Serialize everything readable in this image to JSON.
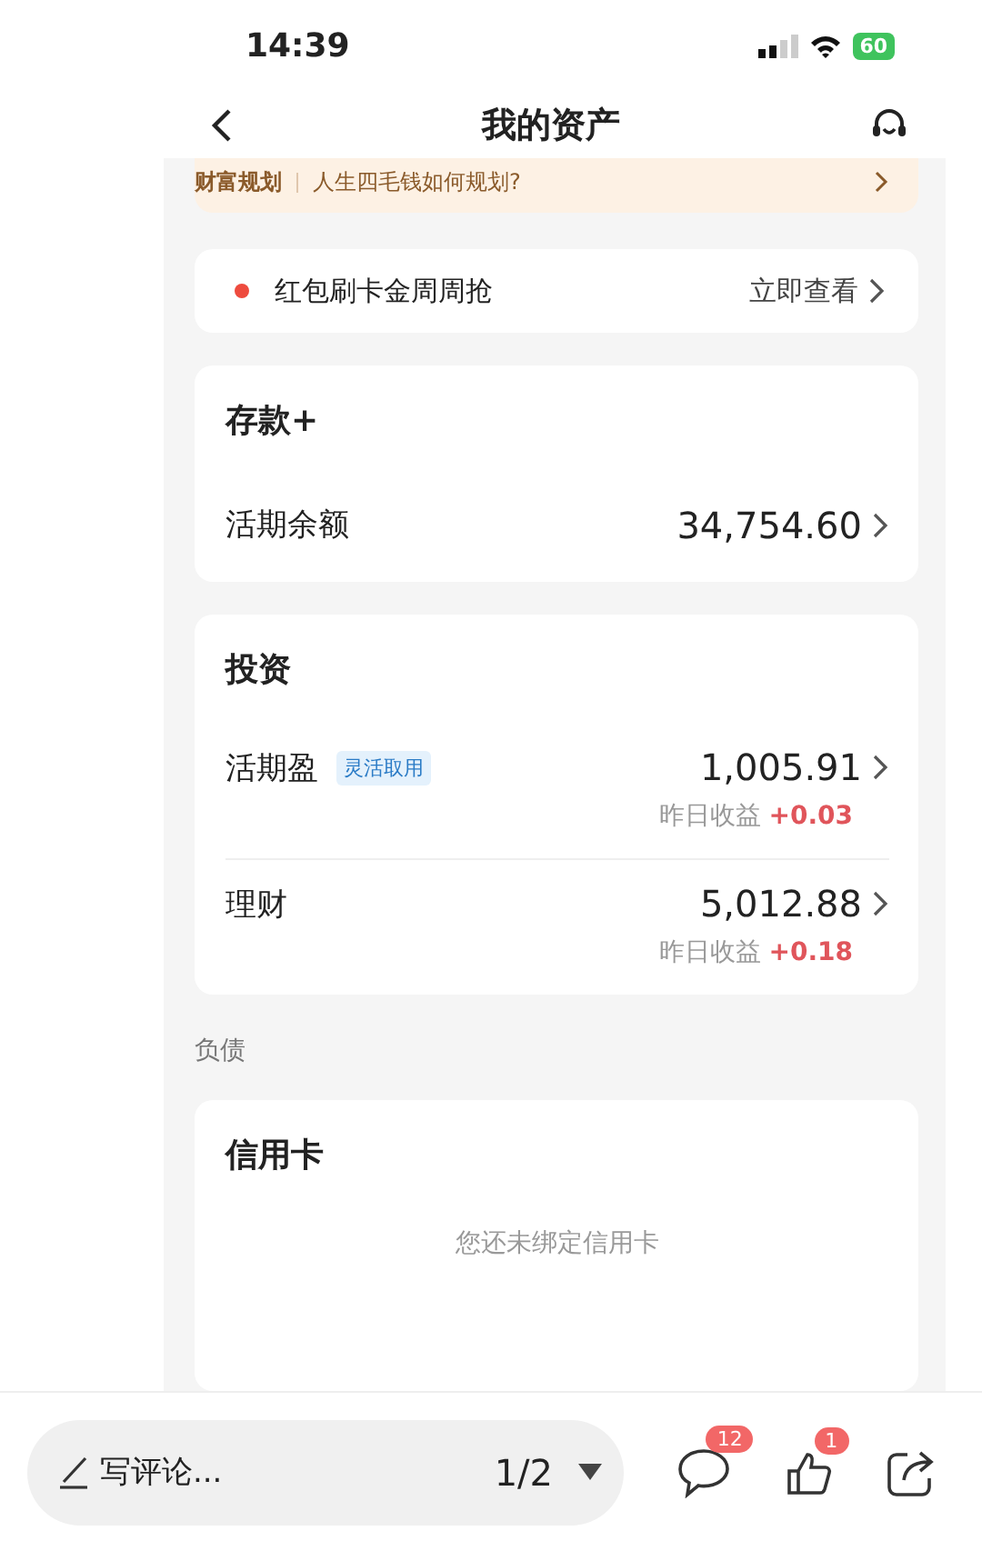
{
  "status_bar": {
    "time": "14:39",
    "battery": "60"
  },
  "nav": {
    "title": "我的资产"
  },
  "banner": {
    "tag": "财富规划",
    "text": "人生四毛钱如何规划?"
  },
  "promo": {
    "text": "红包刷卡金周周抢",
    "link": "立即查看"
  },
  "deposit": {
    "title": "存款+",
    "rows": [
      {
        "label": "活期余额",
        "amount": "34,754.60"
      }
    ]
  },
  "invest": {
    "title": "投资",
    "rows": [
      {
        "label": "活期盈",
        "tag": "灵活取用",
        "amount": "1,005.91",
        "earnings_label": "昨日收益",
        "earnings": "+0.03"
      },
      {
        "label": "理财",
        "amount": "5,012.88",
        "earnings_label": "昨日收益",
        "earnings": "+0.18"
      }
    ]
  },
  "debt": {
    "label": "负债",
    "title": "信用卡",
    "empty": "您还未绑定信用卡"
  },
  "bottom_bar": {
    "comment_placeholder": "写评论...",
    "page": "1/2",
    "comment_count": "12",
    "like_count": "1"
  }
}
